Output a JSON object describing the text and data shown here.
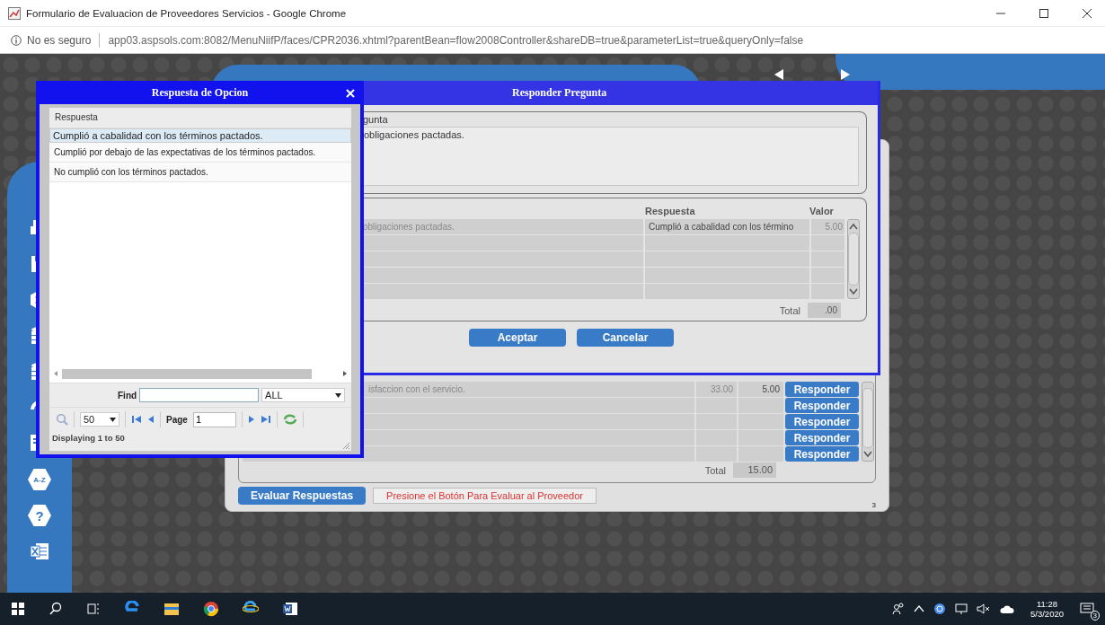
{
  "browser": {
    "title": "Formulario de Evaluacion de Proveedores Servicios - Google Chrome",
    "security": "No es seguro",
    "url": "app03.aspsols.com:8082/MenuNiifP/faces/CPR2036.xhtml?parentBean=flow2008Controller&shareDB=true&parameterList=true&queryOnly=false"
  },
  "sidebar": {
    "sort_label": "A-Z",
    "help_label": "?"
  },
  "main_panel": {
    "rows": [
      {
        "question": "isfaccion con el servicio.",
        "column_2": "33.00",
        "value": "5.00",
        "action": "Responder"
      },
      {
        "action": "Responder"
      },
      {
        "action": "Responder"
      },
      {
        "action": "Responder"
      },
      {
        "action": "Responder"
      }
    ],
    "total_label": "Total",
    "total": "15.00",
    "evaluate_button": "Evaluar Respuestas",
    "message": "Presione el Botón Para Evaluar al Proveedor",
    "page_number": "3"
  },
  "responder_dialog": {
    "title": "Responder Pregunta",
    "legend": "gunta",
    "question": "obligaciones pactadas.",
    "columns": [
      "Respuesta",
      "Valor"
    ],
    "rows": [
      {
        "question": "obligaciones pactadas.",
        "answer": "Cumplió a cabalidad con los término",
        "value": "5.00"
      }
    ],
    "total_label": "Total",
    "total": ".00",
    "buttons": [
      "Aceptar",
      "Cancelar"
    ]
  },
  "options_dialog": {
    "title": "Respuesta de Opcion",
    "column": "Respuesta",
    "options": [
      {
        "text": "Cumplió a cabalidad con los términos pactados.",
        "selected": true
      },
      {
        "text": "Cumplió por debajo de las expectativas de los términos pactados.",
        "selected": false
      },
      {
        "text": "No cumplió con los términos pactados.",
        "selected": false
      }
    ],
    "find_label": "Find",
    "find_scope": "ALL",
    "page_size": "50",
    "page_label": "Page",
    "page": "1",
    "status": "Displaying 1 to 50"
  },
  "taskbar": {
    "time": "11:28",
    "date": "5/3/2020",
    "notifications": "3"
  }
}
